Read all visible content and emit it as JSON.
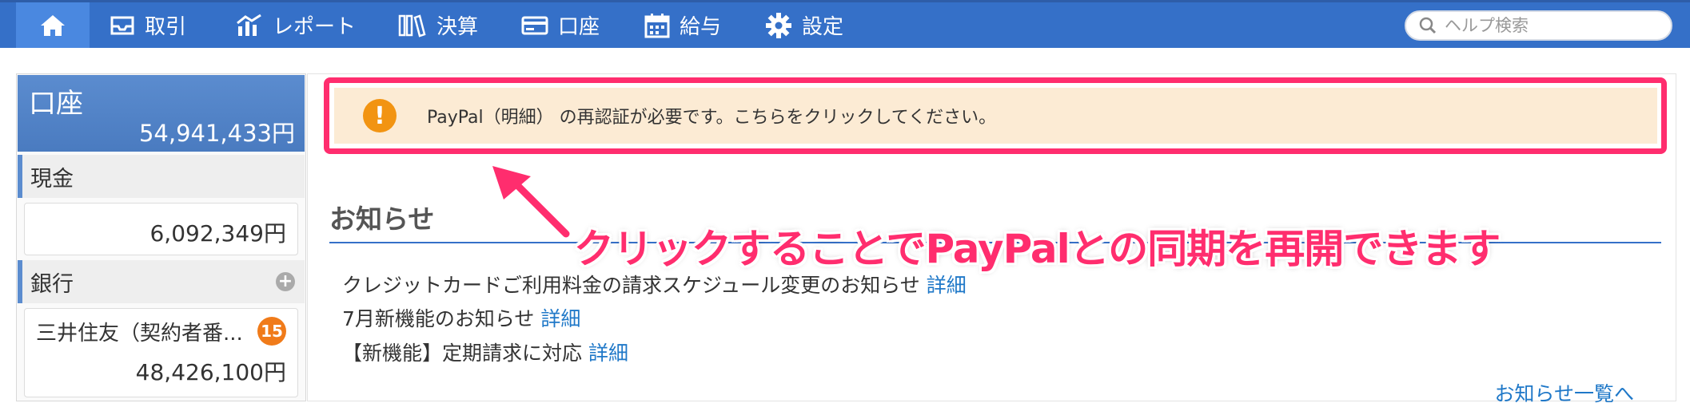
{
  "nav": {
    "items": [
      {
        "label": "取引",
        "icon": "inbox-icon"
      },
      {
        "label": "レポート",
        "icon": "chart-icon"
      },
      {
        "label": "決算",
        "icon": "books-icon"
      },
      {
        "label": "口座",
        "icon": "card-icon"
      },
      {
        "label": "給与",
        "icon": "calendar-icon"
      },
      {
        "label": "設定",
        "icon": "gear-icon"
      }
    ],
    "search_placeholder": "ヘルプ検索",
    "colors": {
      "bar": "#3570c8",
      "active": "#4a88e0"
    }
  },
  "sidebar": {
    "title": "口座",
    "total": "54,941,433円",
    "cash": {
      "label": "現金",
      "amount": "6,092,349円"
    },
    "bank": {
      "label": "銀行",
      "accounts": [
        {
          "name": "三井住友（契約者番...",
          "badge": "15",
          "amount": "48,426,100円"
        }
      ]
    }
  },
  "alert": {
    "text": "PayPal（明細） の再認証が必要です。こちらをクリックしてください。",
    "icon": "exclamation-icon",
    "colors": {
      "background": "#fcebd4",
      "outline": "#ff2d6e"
    }
  },
  "news": {
    "title": "お知らせ",
    "items": [
      {
        "text": "クレジットカードご利用料金の請求スケジュール変更のお知らせ",
        "link": "詳細"
      },
      {
        "text": "7月新機能のお知らせ",
        "link": "詳細"
      },
      {
        "text": "【新機能】定期請求に対応",
        "link": "詳細"
      }
    ],
    "more": "お知らせ一覧へ"
  },
  "annotation": {
    "text": "クリックすることでPayPalとの同期を再開できます"
  }
}
